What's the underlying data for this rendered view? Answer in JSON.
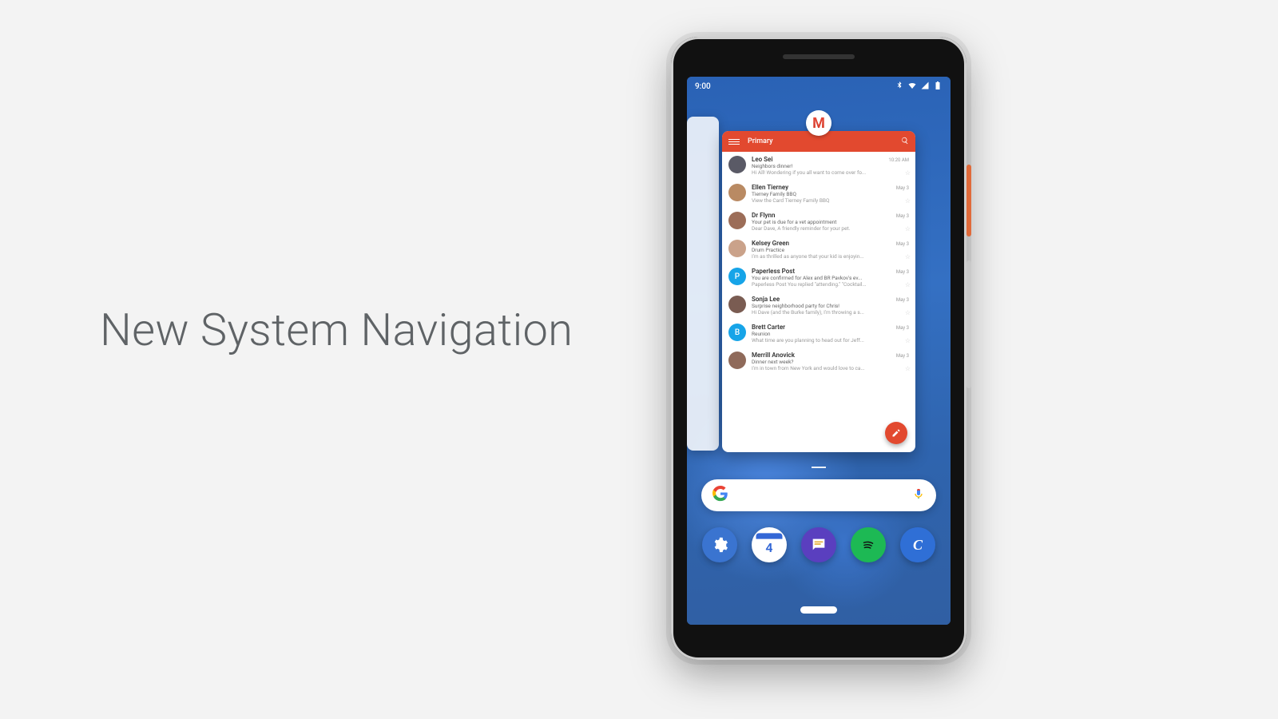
{
  "headline": "New System Navigation",
  "status": {
    "time": "9:00"
  },
  "recents": {
    "app_icon_letter": "M",
    "gmail": {
      "tab": "Primary",
      "emails": [
        {
          "sender": "Leo Sei",
          "time": "10:20 AM",
          "subject": "Neighbors dinner!",
          "preview": "Hi All! Wondering if you all want to come over fo...",
          "avatar": "#5a5a66"
        },
        {
          "sender": "Ellen Tierney",
          "time": "May 3",
          "subject": "Tierney Family BBQ",
          "preview": "View the Card Tierney Family BBQ",
          "avatar": "#b98a63"
        },
        {
          "sender": "Dr Flynn",
          "time": "May 3",
          "subject": "Your pet is due for a vet appointment",
          "preview": "Dear Dave, A friendly reminder for your pet.",
          "avatar": "#9c6d58"
        },
        {
          "sender": "Kelsey Green",
          "time": "May 3",
          "subject": "Drum Practice",
          "preview": "I'm as thrilled as anyone that your kid is enjoyin...",
          "avatar": "#caa28a"
        },
        {
          "sender": "Paperless Post",
          "time": "May 3",
          "subject": "You are confirmed for Alex and BR Pavkov's ev...",
          "preview": "Paperless Post You replied \"attending.\" \"Cocktail...",
          "avatar": "#16a4e8",
          "initial": "P"
        },
        {
          "sender": "Sonja Lee",
          "time": "May 3",
          "subject": "Surprise neighborhood party for Chris!",
          "preview": "Hi Dave (and the Burke family), I'm throwing a s...",
          "avatar": "#7a5c52"
        },
        {
          "sender": "Brett Carter",
          "time": "May 3",
          "subject": "Reunion",
          "preview": "What time are you planning to head out for Jeff...",
          "avatar": "#16a4e8",
          "initial": "B"
        },
        {
          "sender": "Merrill Anovick",
          "time": "May 3",
          "subject": "Dinner next week?",
          "preview": "I'm in town from New York and would love to ca...",
          "avatar": "#8f6a5a"
        }
      ]
    }
  },
  "favorites": [
    {
      "name": "settings",
      "bg": "#3a74d0"
    },
    {
      "name": "calendar",
      "bg": "#ffffff",
      "badge": "4"
    },
    {
      "name": "messages",
      "bg": "#5a3fbf"
    },
    {
      "name": "spotify",
      "bg": "#1db954"
    },
    {
      "name": "app-c",
      "bg": "#2f6fd6",
      "initial": "C"
    }
  ],
  "colors": {
    "gmail_red": "#e2492f"
  }
}
